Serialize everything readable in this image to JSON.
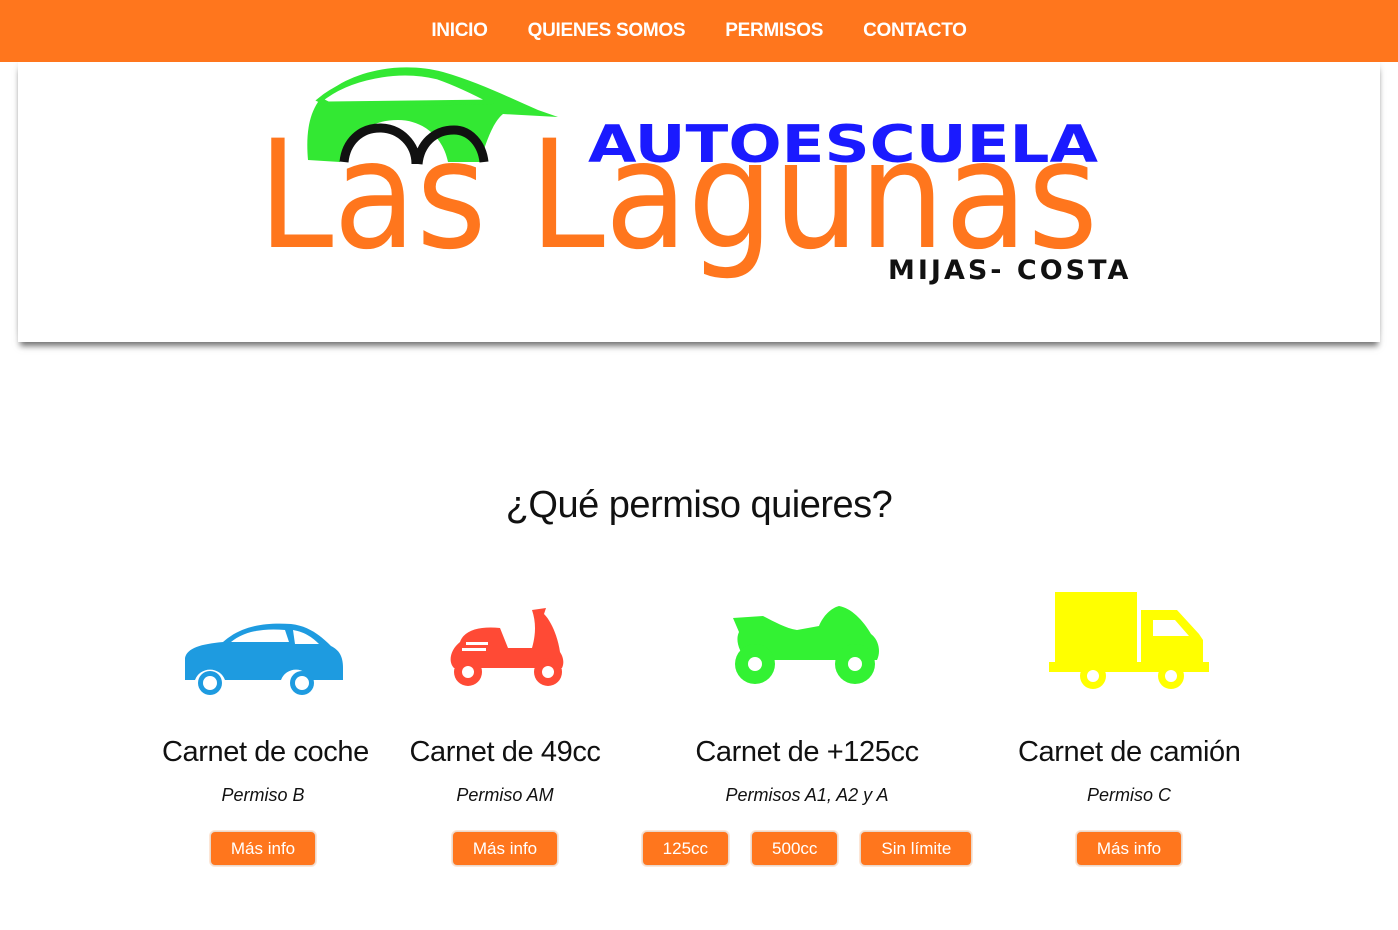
{
  "nav": {
    "items": [
      "INICIO",
      "QUIENES SOMOS",
      "PERMISOS",
      "CONTACTO"
    ]
  },
  "logo": {
    "top_line": "AUTOESCUELA",
    "main": "Las Lagunas",
    "sub": "MIJAS- COSTA",
    "colors": {
      "orange": "#ff761d",
      "blue": "#1a1aff",
      "green": "#33e833"
    }
  },
  "section": {
    "title": "¿Qué permiso quieres?"
  },
  "cards": [
    {
      "icon": "car-icon",
      "color": "#1e9be0",
      "title": "Carnet de coche",
      "subtitle": "Permiso B",
      "buttons": [
        "Más info"
      ]
    },
    {
      "icon": "scooter-icon",
      "color": "#ff4a35",
      "title": "Carnet de 49cc",
      "subtitle": "Permiso AM",
      "buttons": [
        "Más info"
      ]
    },
    {
      "icon": "motorcycle-icon",
      "color": "#33f233",
      "title": "Carnet de +125cc",
      "subtitle": "Permisos A1, A2 y A",
      "buttons": [
        "125cc",
        "500cc",
        "Sin límite"
      ]
    },
    {
      "icon": "truck-icon",
      "color": "#ffff00",
      "title": "Carnet de camión",
      "subtitle": "Permiso C",
      "buttons": [
        "Más info"
      ]
    }
  ]
}
